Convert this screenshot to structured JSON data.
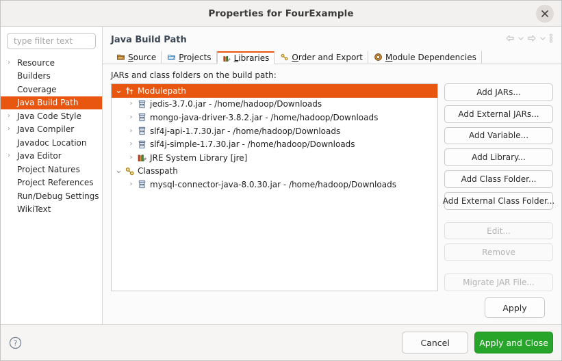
{
  "window": {
    "title": "Properties for FourExample",
    "close_icon": "close-icon"
  },
  "sidebar": {
    "filter": {
      "placeholder": "type filter text",
      "value": ""
    },
    "items": [
      {
        "label": "Resource",
        "expandable": true,
        "selected": false
      },
      {
        "label": "Builders",
        "expandable": false,
        "selected": false
      },
      {
        "label": "Coverage",
        "expandable": false,
        "selected": false
      },
      {
        "label": "Java Build Path",
        "expandable": false,
        "selected": true
      },
      {
        "label": "Java Code Style",
        "expandable": true,
        "selected": false
      },
      {
        "label": "Java Compiler",
        "expandable": true,
        "selected": false
      },
      {
        "label": "Javadoc Location",
        "expandable": false,
        "selected": false
      },
      {
        "label": "Java Editor",
        "expandable": true,
        "selected": false
      },
      {
        "label": "Project Natures",
        "expandable": false,
        "selected": false
      },
      {
        "label": "Project References",
        "expandable": false,
        "selected": false
      },
      {
        "label": "Run/Debug Settings",
        "expandable": false,
        "selected": false
      },
      {
        "label": "WikiText",
        "expandable": false,
        "selected": false
      }
    ]
  },
  "page": {
    "title": "Java Build Path",
    "header_tools": [
      {
        "name": "back-arrow-icon"
      },
      {
        "name": "back-dropdown-chevron-icon"
      },
      {
        "name": "forward-arrow-icon"
      },
      {
        "name": "forward-dropdown-chevron-icon"
      },
      {
        "name": "view-menu-icon"
      }
    ]
  },
  "tabs": [
    {
      "label": "Source",
      "mnemonic": "S",
      "icon": "source-folder-icon",
      "active": false
    },
    {
      "label": "Projects",
      "mnemonic": "P",
      "icon": "projects-folder-icon",
      "active": false
    },
    {
      "label": "Libraries",
      "mnemonic": "L",
      "icon": "libraries-books-icon",
      "active": true
    },
    {
      "label": "Order and Export",
      "mnemonic": "O",
      "icon": "order-export-icon",
      "active": false
    },
    {
      "label": "Module Dependencies",
      "mnemonic": "M",
      "icon": "module-dependencies-icon",
      "active": false
    }
  ],
  "main": {
    "caption": "JARs and class folders on the build path:",
    "tree": [
      {
        "label": "Modulepath",
        "icon": "modulepath-icon",
        "depth": 0,
        "twisty": "expanded",
        "selected": true
      },
      {
        "label": "jedis-3.7.0.jar - /home/hadoop/Downloads",
        "icon": "jar-icon",
        "depth": 1,
        "twisty": "collapsed",
        "selected": false
      },
      {
        "label": "mongo-java-driver-3.8.2.jar - /home/hadoop/Downloads",
        "icon": "jar-icon",
        "depth": 1,
        "twisty": "collapsed",
        "selected": false
      },
      {
        "label": "slf4j-api-1.7.30.jar - /home/hadoop/Downloads",
        "icon": "jar-icon",
        "depth": 1,
        "twisty": "collapsed",
        "selected": false
      },
      {
        "label": "slf4j-simple-1.7.30.jar - /home/hadoop/Downloads",
        "icon": "jar-icon",
        "depth": 1,
        "twisty": "collapsed",
        "selected": false
      },
      {
        "label": "JRE System Library [jre]",
        "icon": "jre-library-icon",
        "depth": 1,
        "twisty": "collapsed",
        "selected": false
      },
      {
        "label": "Classpath",
        "icon": "classpath-icon",
        "depth": 0,
        "twisty": "expanded",
        "selected": false
      },
      {
        "label": "mysql-connector-java-8.0.30.jar - /home/hadoop/Downloads",
        "icon": "jar-icon",
        "depth": 1,
        "twisty": "collapsed",
        "selected": false
      }
    ],
    "side_buttons": [
      {
        "label": "Add JARs...",
        "enabled": true,
        "gap_above": false
      },
      {
        "label": "Add External JARs...",
        "enabled": true,
        "gap_above": false
      },
      {
        "label": "Add Variable...",
        "enabled": true,
        "gap_above": false
      },
      {
        "label": "Add Library...",
        "enabled": true,
        "gap_above": false
      },
      {
        "label": "Add Class Folder...",
        "enabled": true,
        "gap_above": false
      },
      {
        "label": "Add External Class Folder...",
        "enabled": true,
        "gap_above": false
      },
      {
        "label": "Edit...",
        "enabled": false,
        "gap_above": true
      },
      {
        "label": "Remove",
        "enabled": false,
        "gap_above": false
      },
      {
        "label": "Migrate JAR File...",
        "enabled": false,
        "gap_above": true
      }
    ],
    "apply_label": "Apply"
  },
  "footer": {
    "help_icon": "help-icon",
    "cancel_label": "Cancel",
    "apply_close_label": "Apply and Close"
  },
  "colors": {
    "selection_orange": "#e8560f",
    "apply_close_green": "#26a52a",
    "titlebar_bg": "#f2f1f0",
    "footer_bg": "#f6f5f4"
  }
}
